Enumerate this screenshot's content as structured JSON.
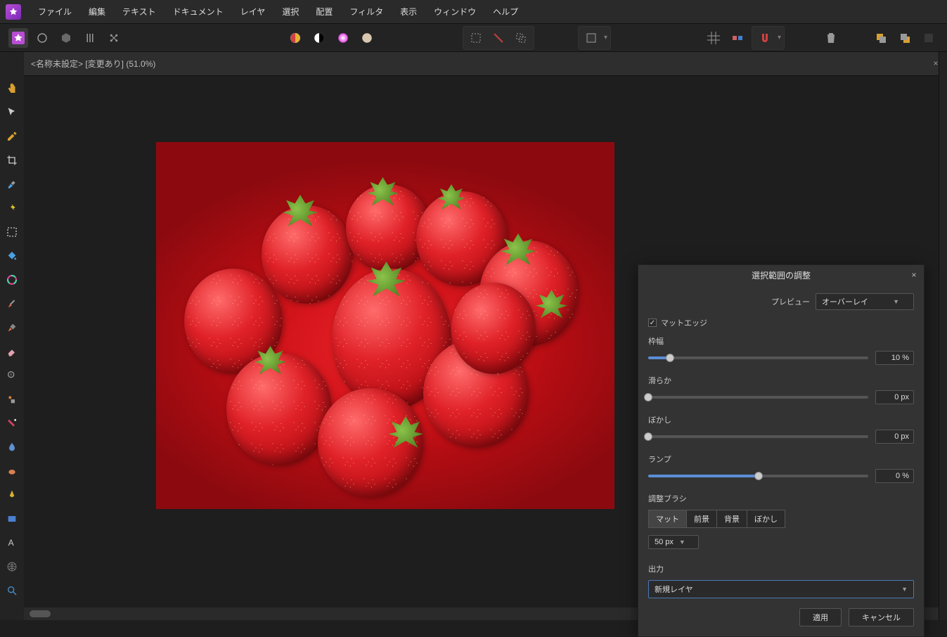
{
  "menu": {
    "items": [
      "ファイル",
      "編集",
      "テキスト",
      "ドキュメント",
      "レイヤ",
      "選択",
      "配置",
      "フィルタ",
      "表示",
      "ウィンドウ",
      "ヘルプ"
    ]
  },
  "document": {
    "tab_title": "<名称未設定> [変更あり] (51.0%)"
  },
  "dialog": {
    "title": "選択範囲の調整",
    "preview_label": "プレビュー",
    "preview_value": "オーバーレイ",
    "matte_edge_label": "マットエッジ",
    "sliders": {
      "border": {
        "label": "枠幅",
        "value": "10 %",
        "pct": 10
      },
      "smooth": {
        "label": "滑らか",
        "value": "0 px",
        "pct": 0
      },
      "feather": {
        "label": "ぼかし",
        "value": "0 px",
        "pct": 0
      },
      "ramp": {
        "label": "ランプ",
        "value": "0 %",
        "pct": 50
      }
    },
    "brush_section": "調整ブラシ",
    "brush_buttons": [
      "マット",
      "前景",
      "背景",
      "ぼかし"
    ],
    "brush_size": "50 px",
    "output_label": "出力",
    "output_value": "新規レイヤ",
    "apply": "適用",
    "cancel": "キャンセル"
  },
  "tools": {
    "side": [
      "hand",
      "move",
      "color-picker",
      "crop",
      "brush",
      "healing",
      "marquee",
      "flood",
      "paint-mixer",
      "paint-brush",
      "pixel",
      "eraser",
      "view",
      "person",
      "retouch",
      "blur",
      "smudge",
      "pen",
      "rectangle",
      "text",
      "mesh",
      "zoom"
    ]
  }
}
